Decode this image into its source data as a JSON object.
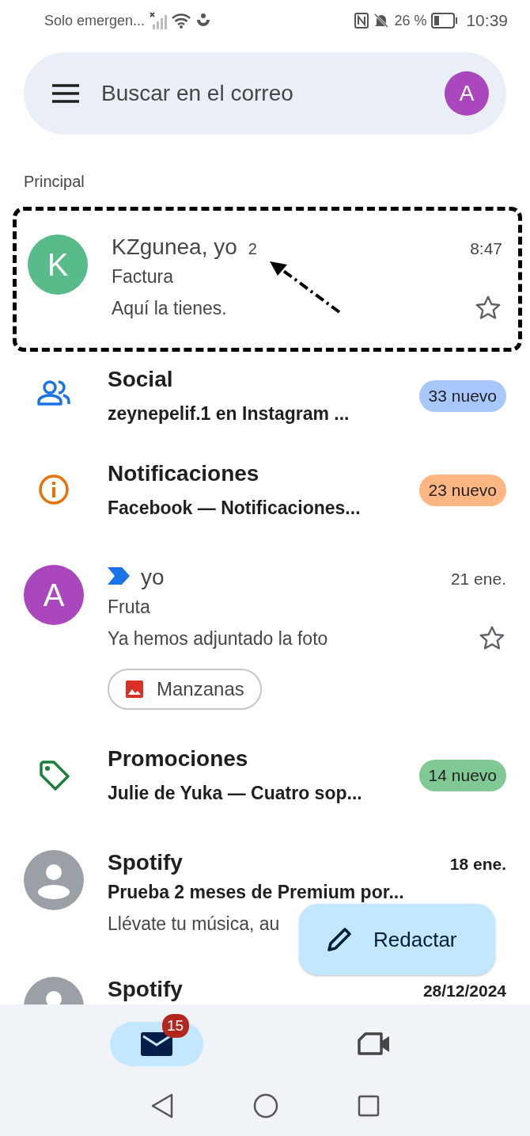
{
  "status_bar": {
    "carrier": "Solo emergen...",
    "battery_percent": "26 %",
    "time": "10:39"
  },
  "search": {
    "placeholder": "Buscar en el correo",
    "avatar_letter": "A"
  },
  "section_label": "Principal",
  "items": [
    {
      "kind": "email",
      "highlighted": true,
      "avatar": "K",
      "color": "#57bb8a",
      "sender": "KZgunea, yo",
      "count": "2",
      "subject": "Factura",
      "snippet": "Aquí la tienes.",
      "time": "8:47",
      "unread": false,
      "starred": false
    },
    {
      "kind": "social",
      "title": "Social",
      "subtitle": "zeynepelif.1 en Instagram ...",
      "badge": "33 nuevo",
      "color": "#a8c7fa"
    },
    {
      "kind": "notifications",
      "title": "Notificaciones",
      "subtitle": "Facebook — Notificaciones...",
      "badge": "23 nuevo",
      "color": "#ffb682"
    },
    {
      "kind": "email",
      "highlighted": false,
      "avatar": "A",
      "color": "#aa47bc",
      "important": true,
      "sender": "yo",
      "subject": "Fruta",
      "snippet": "Ya hemos adjuntado la foto",
      "time": "21 ene.",
      "unread": false,
      "starred": false,
      "attachment": "Manzanas"
    },
    {
      "kind": "promotions",
      "title": "Promociones",
      "subtitle": "Julie de Yuka — Cuatro sop...",
      "badge": "14 nuevo",
      "color": "#80c995"
    },
    {
      "kind": "email",
      "highlighted": false,
      "color": "#9aa0a6",
      "sender": "Spotify",
      "subject": "Prueba 2 meses de Premium por...",
      "snippet": "Llévate tu música, au",
      "time": "18 ene.",
      "unread": true
    },
    {
      "kind": "email",
      "highlighted": false,
      "color": "#9aa0a6",
      "sender": "Spotify",
      "time": "28/12/2024",
      "unread": true
    }
  ],
  "compose": {
    "label": "Redactar"
  },
  "bottom_nav": [
    {
      "selected": true,
      "badge": "15"
    },
    {
      "selected": false
    }
  ]
}
